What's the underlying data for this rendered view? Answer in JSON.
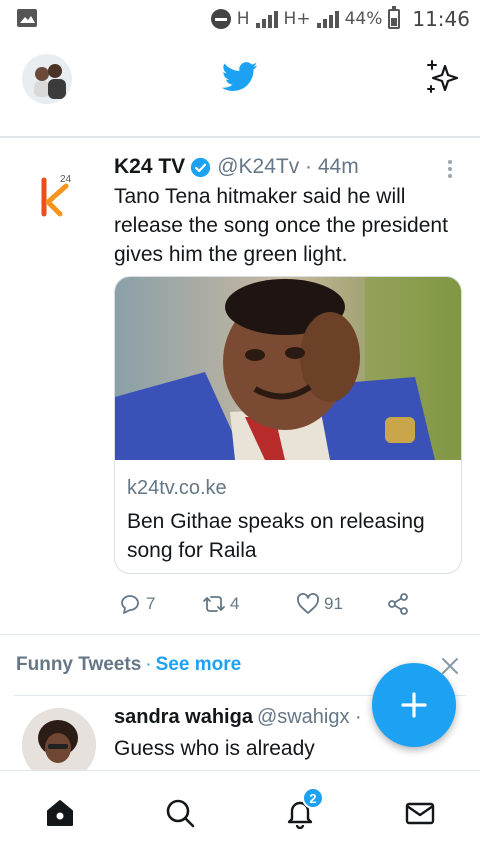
{
  "status_bar": {
    "network_1": "H",
    "network_2": "H+",
    "battery": "44%",
    "time": "11:46"
  },
  "colors": {
    "accent": "#1da1f2",
    "text_primary": "#14171a",
    "text_secondary": "#657786",
    "divider": "#e1e8ed",
    "k24_brand": "#f7941d"
  },
  "app_bar": {
    "logo_icon": "twitter-bird-icon",
    "right_icon": "sparkle-icon"
  },
  "tweet": {
    "name": "K24 TV",
    "handle": "@K24Tv · 44m",
    "text": "Tano Tena hitmaker said he will release the song once the president gives him the green light.",
    "logo_text": "24",
    "card": {
      "domain": "k24tv.co.ke",
      "title": "Ben Githae speaks on releasing song for Raila"
    },
    "actions": {
      "replies": "7",
      "retweets": "4",
      "likes": "91"
    }
  },
  "section": {
    "title": "Funny Tweets",
    "separator": "·",
    "see_more": "See more"
  },
  "next_tweet": {
    "name": "sandra wahiga",
    "handle": "@swahigx ·",
    "text": "Guess who is already"
  },
  "bottom_nav": {
    "notifications_badge": "2"
  }
}
